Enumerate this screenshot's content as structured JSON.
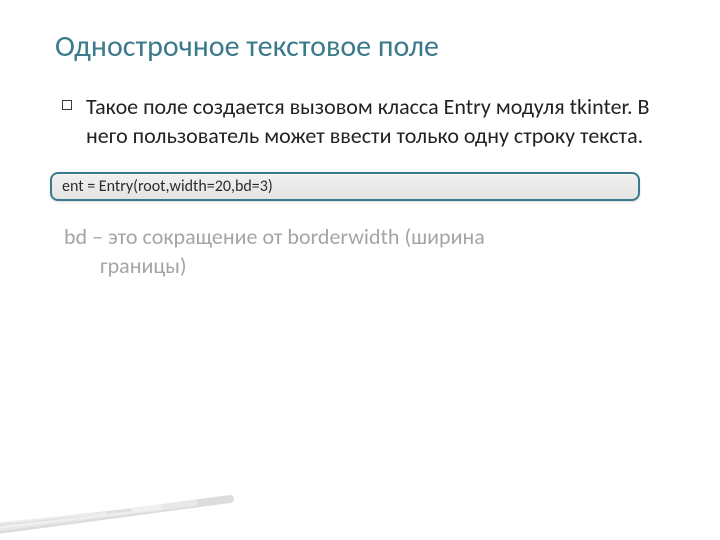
{
  "title": "Однострочное текстовое поле",
  "bullet": "Такое поле создается вызовом класса Entry модуля tkinter. В него пользователь может ввести только одну строку текста.",
  "code": "ent = Entry(root,width=20,bd=3)",
  "note_line1": "bd – это сокращение от borderwidth (ширина",
  "note_line2": "границы)"
}
